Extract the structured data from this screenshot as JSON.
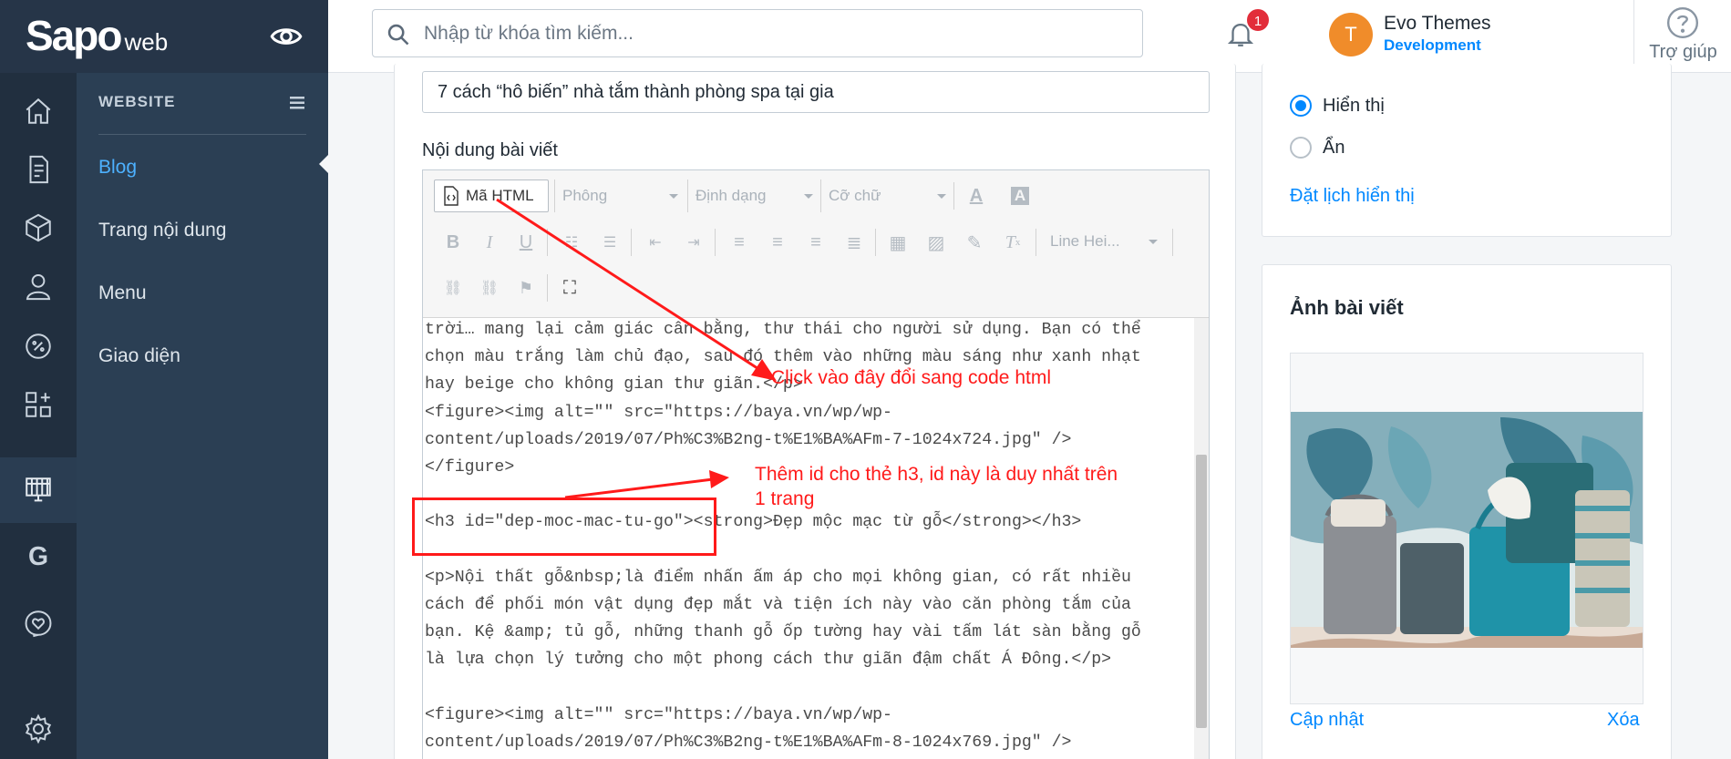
{
  "brand": {
    "logo": "Sapo",
    "logo_suffix": "web"
  },
  "search": {
    "placeholder": "Nhập từ khóa tìm kiếm..."
  },
  "notifications": {
    "count": "1"
  },
  "user": {
    "initial": "T",
    "name": "Evo Themes",
    "store": "Development"
  },
  "help": {
    "label": "Trợ giúp"
  },
  "sidebar": {
    "section": "WEBSITE",
    "items": [
      {
        "label": "Blog",
        "active": true
      },
      {
        "label": "Trang nội dung"
      },
      {
        "label": "Menu"
      },
      {
        "label": "Giao diện"
      }
    ]
  },
  "post": {
    "title": "7 cách “hô biến” nhà tắm thành phòng spa tại gia",
    "content_label": "Nội dung bài viết"
  },
  "toolbar": {
    "html_label": "Mã HTML",
    "font_label": "Phông",
    "format_label": "Định dạng",
    "size_label": "Cỡ chữ",
    "line_height_label": "Line Hei..."
  },
  "code_lines": [
    "trời… mang lại cảm giác cân bằng, thư thái cho người sử dụng. Bạn có thể",
    "chọn màu trắng làm chủ đạo, sau đó thêm vào những màu sáng như xanh nhạt",
    "hay beige cho không gian thư giãn.</p>",
    "<figure><img alt=\"\" src=\"https://baya.vn/wp/wp-",
    "content/uploads/2019/07/Ph%C3%B2ng-t%E1%BA%AFm-7-1024x724.jpg\" />",
    "</figure>",
    "",
    "<h3 id=\"dep-moc-mac-tu-go\"><strong>Đẹp mộc mạc từ gỗ</strong></h3>",
    "",
    "<p>Nội thất gỗ&nbsp;là điểm nhấn ấm áp cho mọi không gian, có rất nhiều",
    "cách để phối món vật dụng đẹp mắt và tiện ích này vào căn phòng tắm của",
    "bạn. Kệ &amp; tủ gỗ, những thanh gỗ ốp tường hay vài tấm lát sàn bằng gỗ",
    "là lựa chọn lý tưởng cho một phong cách thư giãn đậm chất Á Đông.</p>",
    "",
    "<figure><img alt=\"\" src=\"https://baya.vn/wp/wp-",
    "content/uploads/2019/07/Ph%C3%B2ng-t%E1%BA%AFm-8-1024x769.jpg\" />"
  ],
  "annotations": {
    "click_html": "Click vào đây đổi sang code html",
    "add_id_line1": "Thêm id cho thẻ h3, id này là duy nhất trên",
    "add_id_line2": "1 trang"
  },
  "visibility": {
    "show_label": "Hiển thị",
    "hide_label": "Ẩn",
    "selected": "Hiển thị",
    "schedule_link": "Đặt lịch hiển thị"
  },
  "featured_image": {
    "title": "Ảnh bài viết",
    "update_link": "Cập nhật",
    "delete_link": "Xóa"
  },
  "colors": {
    "accent": "#0088ff",
    "annotation": "#ff1a1a",
    "rail": "#212f3f",
    "sidebar": "#2b3f54"
  }
}
